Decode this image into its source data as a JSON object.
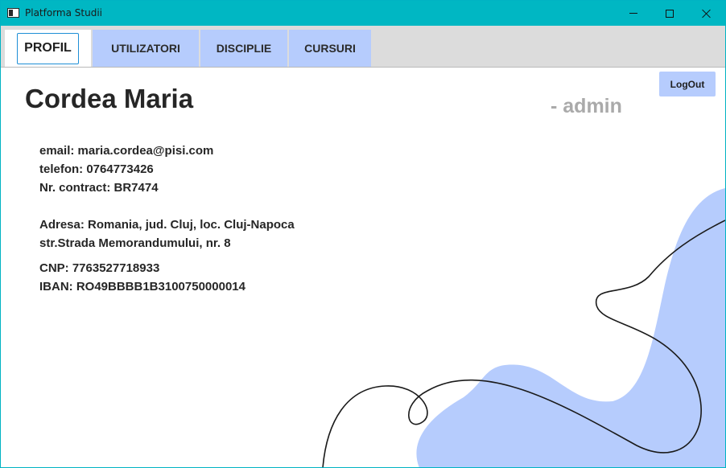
{
  "window": {
    "title": "Platforma Studii",
    "accent": "#00b7c3"
  },
  "tabs": [
    {
      "label": "PROFIL",
      "selected": true
    },
    {
      "label": "UTILIZATORI",
      "selected": false
    },
    {
      "label": "DISCIPLIE",
      "selected": false
    },
    {
      "label": "CURSURI",
      "selected": false
    }
  ],
  "profile": {
    "name": "Cordea Maria",
    "role": "- admin",
    "logout_label": "LogOut",
    "email": "email: maria.cordea@pisi.com",
    "phone": "telefon: 0764773426",
    "contract": "Nr. contract: BR7474",
    "address_line1": "Adresa: Romania, jud. Cluj, loc. Cluj-Napoca",
    "address_line2": "str.Strada Memorandumului, nr. 8",
    "cnp": "CNP: 7763527718933",
    "iban": "IBAN: RO49BBBB1B3100750000014"
  },
  "colors": {
    "tab_background": "#b6ccfd",
    "blob": "#b6ccfd",
    "role_text": "#aaaaaa"
  },
  "icons": [
    "app-icon",
    "minimize-icon",
    "maximize-icon",
    "close-icon"
  ]
}
